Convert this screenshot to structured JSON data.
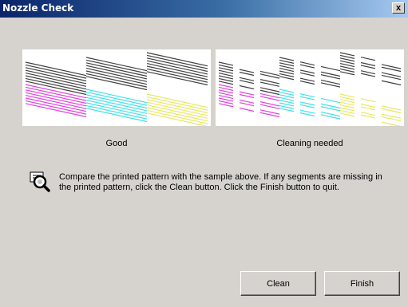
{
  "window": {
    "title": "Nozzle Check",
    "close_label": "x"
  },
  "samples": {
    "good_caption": "Good",
    "bad_caption": "Cleaning needed"
  },
  "info": {
    "icon": "printer-magnifier-icon",
    "message": "Compare the printed pattern with the sample above. If any segments are missing in the printed pattern, click the Clean button. Click the Finish button to quit."
  },
  "buttons": {
    "clean_label": "Clean",
    "finish_label": "Finish"
  },
  "colors": {
    "black": "#404040",
    "magenta": "#e040e0",
    "cyan": "#40e0e8",
    "yellow": "#e8e860",
    "titlebar": "#0a246a"
  }
}
